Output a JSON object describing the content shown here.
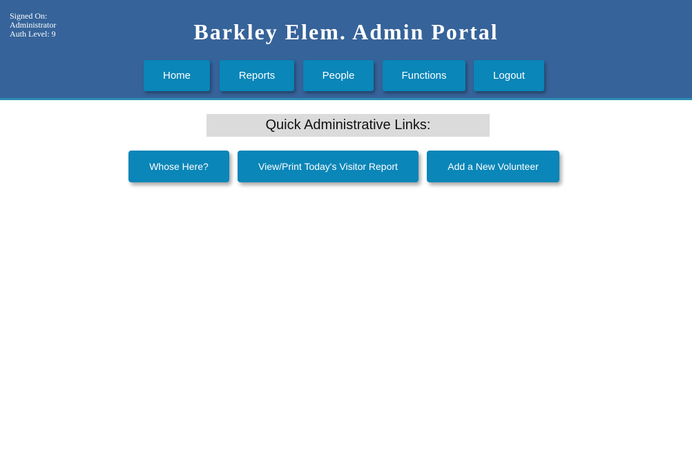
{
  "header": {
    "signon_lines": [
      "Signed On:",
      "Administrator",
      "Auth Level: 9"
    ],
    "title": "Barkley Elem. Admin Portal",
    "background": "#36639a"
  },
  "nav": {
    "items": [
      {
        "label": "Home"
      },
      {
        "label": "Reports"
      },
      {
        "label": "People"
      },
      {
        "label": "Functions"
      },
      {
        "label": "Logout"
      }
    ]
  },
  "main": {
    "heading": "Quick Administrative Links:",
    "quick_links": [
      {
        "label": "Whose Here?"
      },
      {
        "label": "View/Print Today's Visitor Report"
      },
      {
        "label": "Add a New Volunteer"
      }
    ]
  },
  "colors": {
    "button": "#0a86b8",
    "heading_bg": "#dcdbdc"
  }
}
